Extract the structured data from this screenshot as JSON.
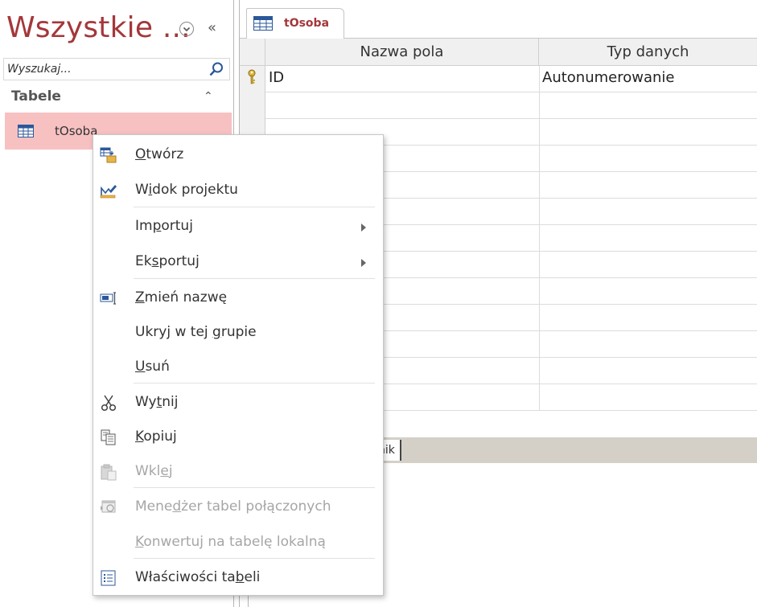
{
  "nav": {
    "title": "Wszystkie ...",
    "search_placeholder": "Wyszukaj...",
    "group_label": "Tabele",
    "items": [
      {
        "label": "tOsoba",
        "icon": "table-icon"
      }
    ]
  },
  "document": {
    "tab_label": "tOsoba",
    "columns": {
      "name": "Nazwa pola",
      "type": "Typ danych"
    },
    "rows": [
      {
        "name": "ID",
        "type": "Autonumerowanie",
        "primary_key": true
      }
    ],
    "lower_tab_label": "nik"
  },
  "context_menu": {
    "items": [
      {
        "key": "open",
        "pre": "",
        "ul": "O",
        "post": "twórz",
        "enabled": true,
        "icon": "open-table-icon"
      },
      {
        "key": "design-view",
        "pre": "W",
        "ul": "i",
        "post": "dok projektu",
        "enabled": true,
        "icon": "design-view-icon"
      },
      {
        "key": "import",
        "pre": "Im",
        "ul": "p",
        "post": "ortuj",
        "enabled": true,
        "submenu": true
      },
      {
        "key": "export",
        "pre": "Ek",
        "ul": "s",
        "post": "portuj",
        "enabled": true,
        "submenu": true
      },
      {
        "key": "rename",
        "pre": "",
        "ul": "Z",
        "post": "mień nazwę",
        "enabled": true,
        "icon": "rename-icon"
      },
      {
        "key": "hide",
        "pre": "Ukryj w tej ",
        "ul": "g",
        "post": "rupie",
        "enabled": true
      },
      {
        "key": "delete",
        "pre": "",
        "ul": "U",
        "post": "suń",
        "enabled": true
      },
      {
        "key": "cut",
        "pre": "Wy",
        "ul": "t",
        "post": "nij",
        "enabled": true,
        "icon": "scissors-icon"
      },
      {
        "key": "copy",
        "pre": "",
        "ul": "K",
        "post": "opiuj",
        "enabled": true,
        "icon": "copy-icon"
      },
      {
        "key": "paste",
        "pre": "Wkl",
        "ul": "e",
        "post": "j",
        "enabled": false,
        "icon": "paste-icon"
      },
      {
        "key": "linked-table-manager",
        "pre": "Mene",
        "ul": "d",
        "post": "żer tabel połączonych",
        "enabled": false,
        "icon": "linked-table-manager-icon"
      },
      {
        "key": "convert-local",
        "pre": "",
        "ul": "K",
        "post": "onwertuj na tabelę lokalną",
        "enabled": false
      },
      {
        "key": "properties",
        "pre": "Właściwości ta",
        "ul": "b",
        "post": "eli",
        "enabled": true,
        "icon": "properties-icon"
      }
    ]
  }
}
